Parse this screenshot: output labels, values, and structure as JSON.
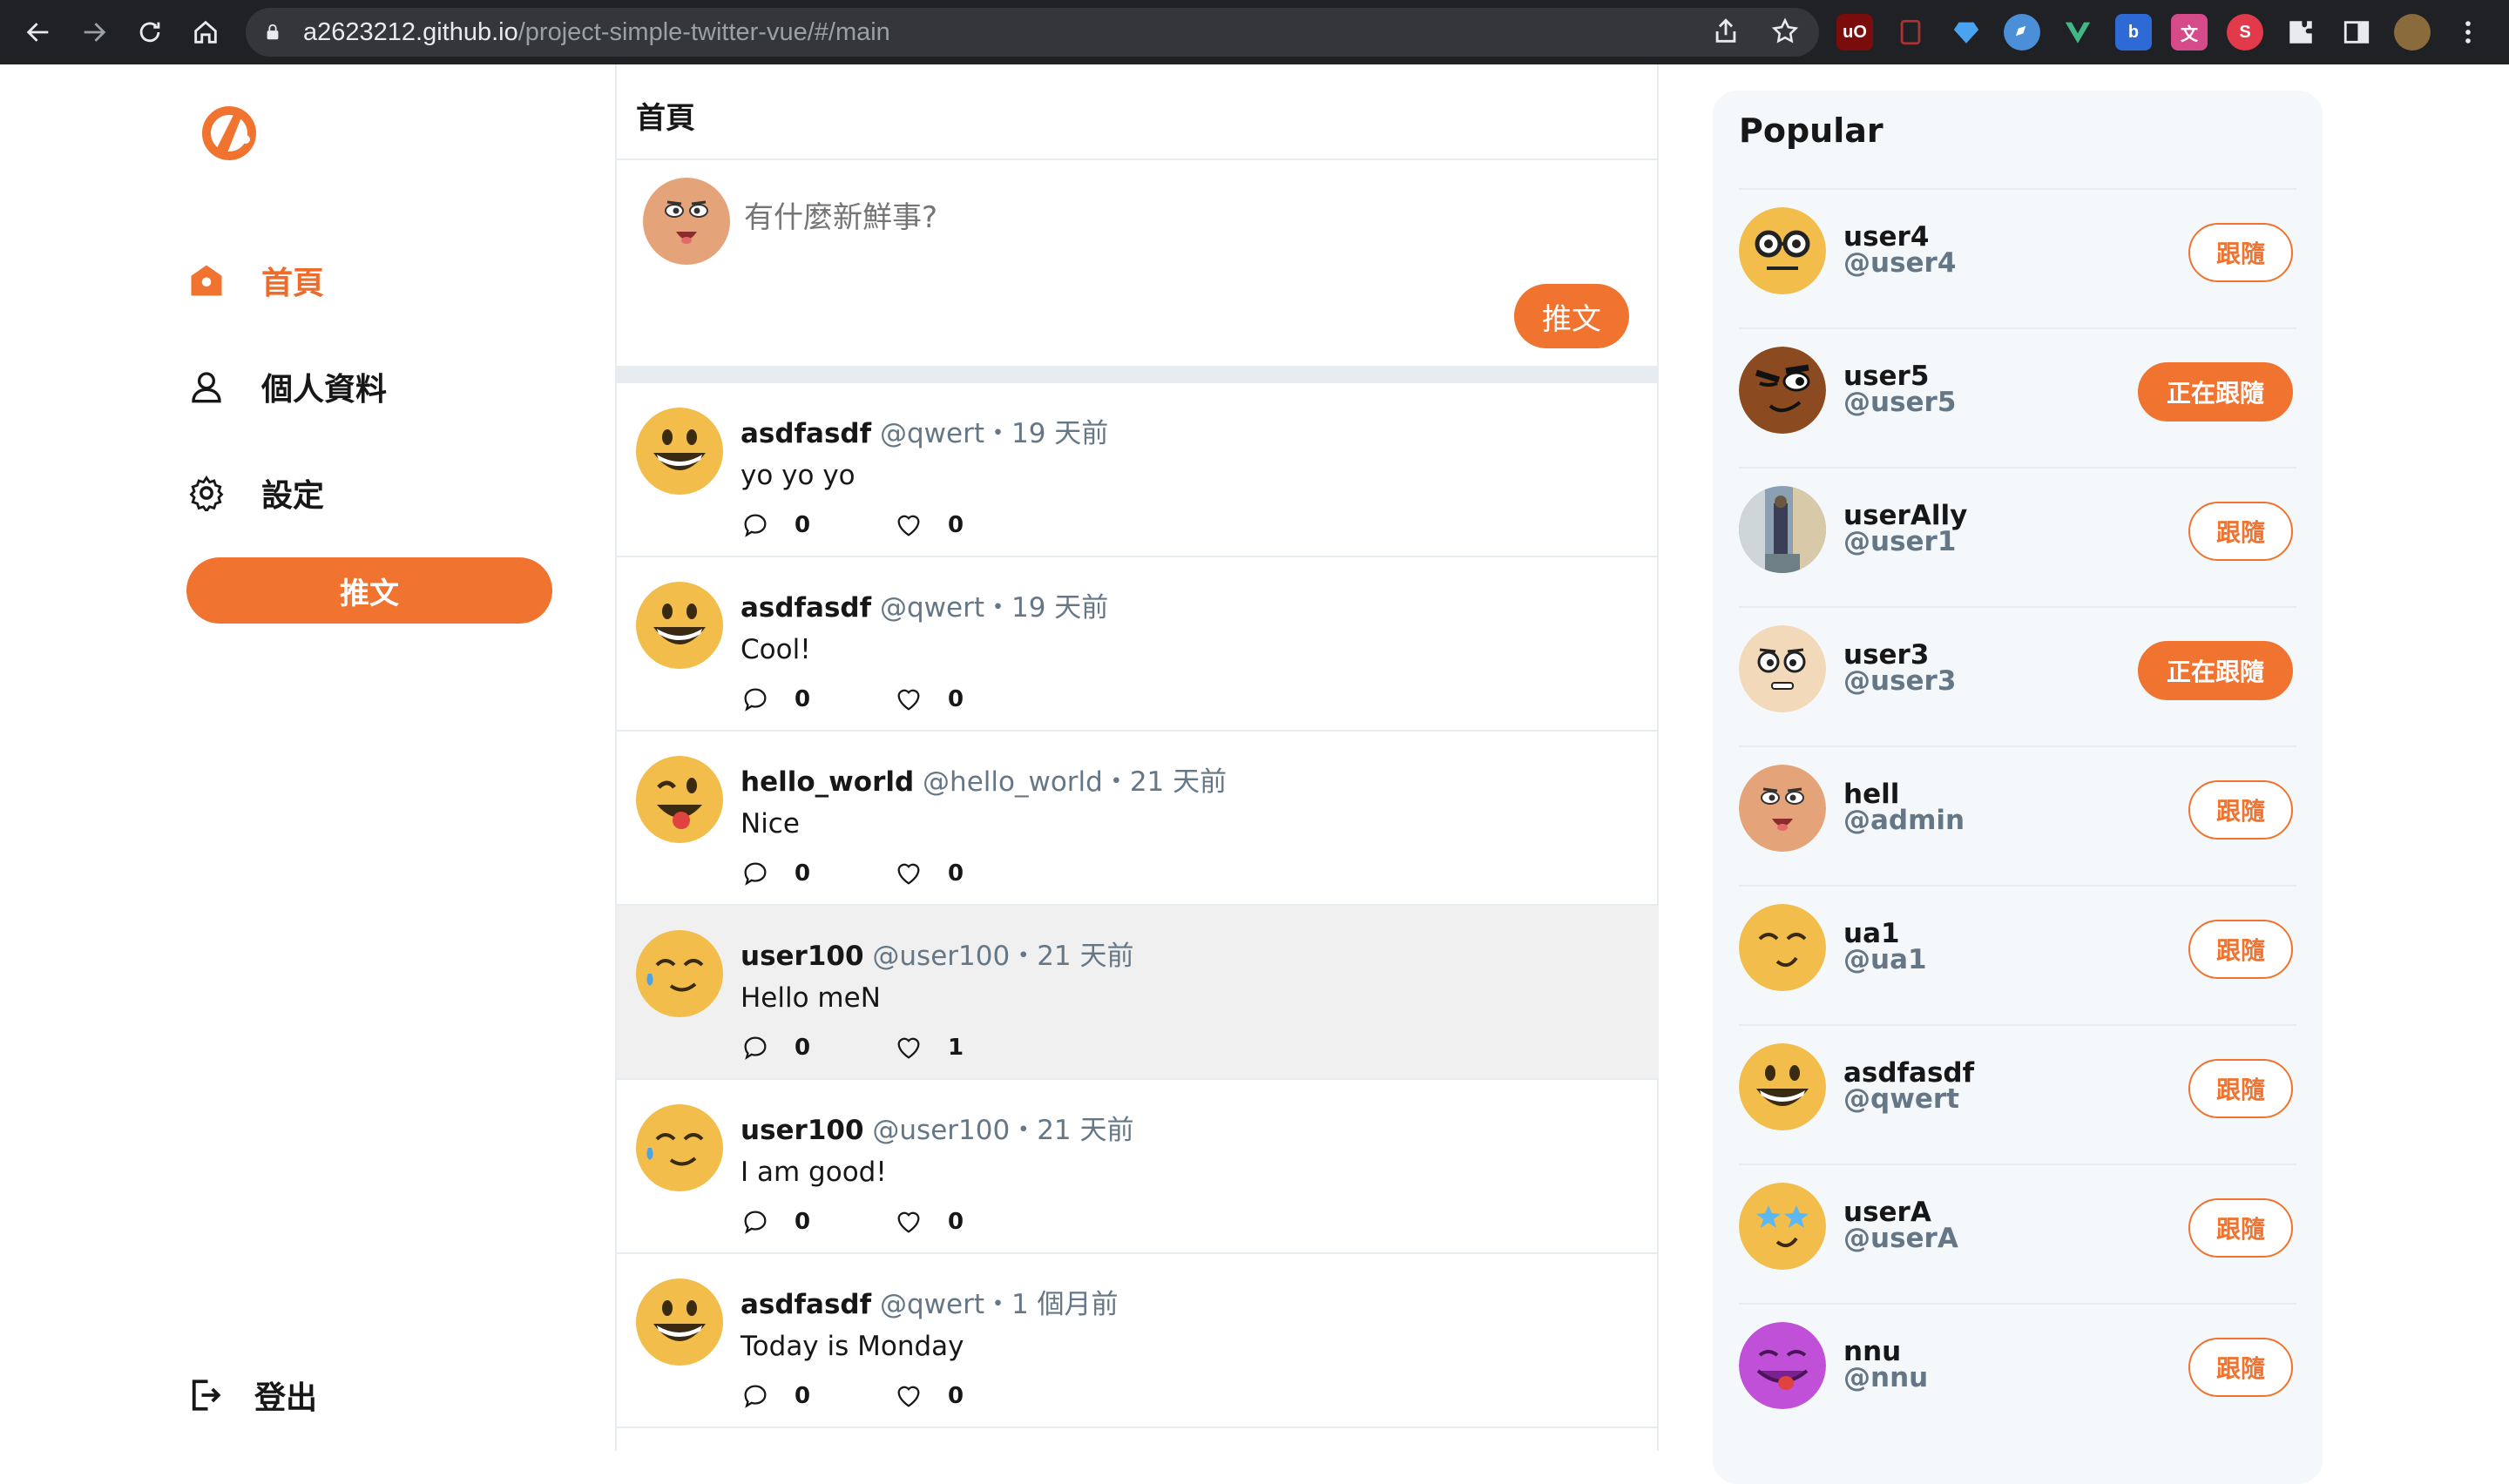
{
  "browser": {
    "url_host": "a2623212.github.io",
    "url_path": "/project-simple-twitter-vue/#/main"
  },
  "sidebar": {
    "items": [
      {
        "label": "首頁",
        "icon": "home-icon",
        "active": true
      },
      {
        "label": "個人資料",
        "icon": "user-icon",
        "active": false
      },
      {
        "label": "設定",
        "icon": "gear-icon",
        "active": false
      }
    ],
    "tweet_button": "推文",
    "logout": "登出"
  },
  "main": {
    "title": "首頁",
    "compose_placeholder": "有什麼新鮮事?",
    "compose_button": "推文",
    "tweets": [
      {
        "name": "asdfasdf",
        "meta": "@qwert・19 天前",
        "body": "yo yo yo",
        "replies": "0",
        "likes": "0",
        "avatar": "grin"
      },
      {
        "name": "asdfasdf",
        "meta": "@qwert・19 天前",
        "body": "Cool!",
        "replies": "0",
        "likes": "0",
        "avatar": "grin"
      },
      {
        "name": "hello_world",
        "meta": "@hello_world・21 天前",
        "body": "Nice",
        "replies": "0",
        "likes": "0",
        "avatar": "tongue"
      },
      {
        "name": "user100",
        "meta": "@user100・21 天前",
        "body": "Hello meN",
        "replies": "0",
        "likes": "1",
        "avatar": "sweat"
      },
      {
        "name": "user100",
        "meta": "@user100・21 天前",
        "body": "I am good!",
        "replies": "0",
        "likes": "0",
        "avatar": "sweat"
      },
      {
        "name": "asdfasdf",
        "meta": "@qwert・1 個月前",
        "body": "Today is Monday",
        "replies": "0",
        "likes": "0",
        "avatar": "grin"
      }
    ]
  },
  "popular": {
    "title": "Popular",
    "users": [
      {
        "name": "user4",
        "handle": "@user4",
        "button": "跟隨",
        "following": false,
        "avatar": "nerd"
      },
      {
        "name": "user5",
        "handle": "@user5",
        "button": "正在跟隨",
        "following": true,
        "avatar": "wink"
      },
      {
        "name": "userAlly",
        "handle": "@user1",
        "button": "跟隨",
        "following": false,
        "avatar": "photo"
      },
      {
        "name": "user3",
        "handle": "@user3",
        "button": "正在跟隨",
        "following": true,
        "avatar": "pale"
      },
      {
        "name": "hell",
        "handle": "@admin",
        "button": "跟隨",
        "following": false,
        "avatar": "tongue-face"
      },
      {
        "name": "ua1",
        "handle": "@ua1",
        "button": "跟隨",
        "following": false,
        "avatar": "smile"
      },
      {
        "name": "asdfasdf",
        "handle": "@qwert",
        "button": "跟隨",
        "following": false,
        "avatar": "grin"
      },
      {
        "name": "userA",
        "handle": "@userA",
        "button": "跟隨",
        "following": false,
        "avatar": "star"
      },
      {
        "name": "nnu",
        "handle": "@nnu",
        "button": "跟隨",
        "following": false,
        "avatar": "purple"
      }
    ]
  },
  "colors": {
    "accent": "#f07330",
    "muted": "#657786",
    "border": "#e6ecf0"
  }
}
